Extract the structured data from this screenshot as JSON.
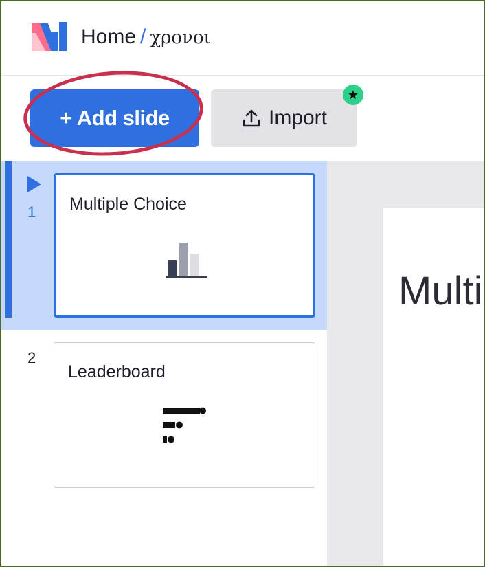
{
  "header": {
    "breadcrumb_home": "Home",
    "breadcrumb_separator": "/",
    "presentation_name": "χρονοι",
    "logo_icon": "mentimeter-logo-icon"
  },
  "toolbar": {
    "add_slide_label": "+ Add slide",
    "import_label": "Import",
    "import_icon": "upload-icon",
    "badge_icon": "star-icon"
  },
  "slides": [
    {
      "number": "1",
      "title": "Multiple Choice",
      "icon": "bar-chart-icon",
      "active": true
    },
    {
      "number": "2",
      "title": "Leaderboard",
      "icon": "leaderboard-icon",
      "active": false
    }
  ],
  "canvas": {
    "slide_heading": "Multi"
  },
  "colors": {
    "accent": "#2f6fe0",
    "active_row": "#c4d9fb",
    "badge": "#2ed18a",
    "annotation": "#c8304e"
  }
}
